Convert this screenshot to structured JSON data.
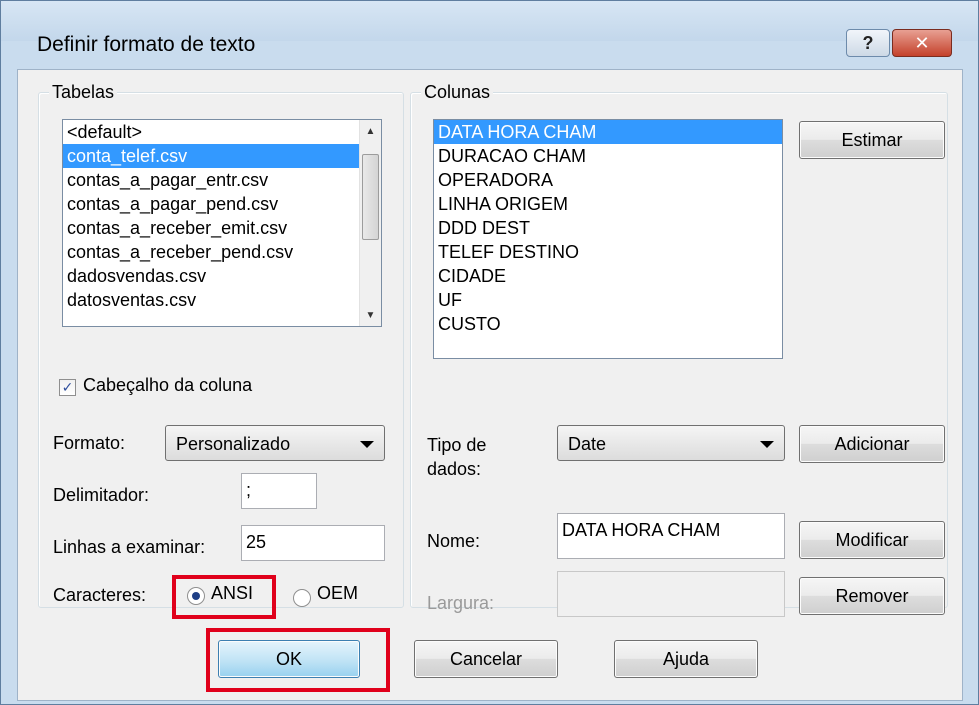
{
  "window": {
    "title": "Definir formato de texto",
    "help_glyph": "?",
    "close_glyph": "✕"
  },
  "tabelas": {
    "legend": "Tabelas",
    "items": [
      "<default>",
      "conta_telef.csv",
      "contas_a_pagar_entr.csv",
      "contas_a_pagar_pend.csv",
      "contas_a_receber_emit.csv",
      "contas_a_receber_pend.csv",
      "dadosvendas.csv",
      "datosventas.csv"
    ],
    "selected": "conta_telef.csv"
  },
  "colunas": {
    "legend": "Colunas",
    "items": [
      "DATA HORA CHAM",
      "DURACAO CHAM",
      "OPERADORA",
      "LINHA ORIGEM",
      "DDD DEST",
      "TELEF DESTINO",
      "CIDADE",
      "UF",
      "CUSTO"
    ],
    "selected": "DATA HORA CHAM",
    "estimar_label": "Estimar"
  },
  "left_form": {
    "header_check_label": "Cabeçalho da coluna",
    "header_checked": true,
    "formato_label": "Formato:",
    "formato_value": "Personalizado",
    "delimitador_label": "Delimitador:",
    "delimitador_value": ";",
    "linhas_label": "Linhas a examinar:",
    "linhas_value": "25",
    "caracteres_label": "Caracteres:",
    "ansi_label": "ANSI",
    "oem_label": "OEM",
    "caracteres_selected": "ANSI"
  },
  "right_form": {
    "tipo_label_line1": "Tipo de",
    "tipo_label_line2": "dados:",
    "tipo_value": "Date",
    "adicionar_label": "Adicionar",
    "nome_label": "Nome:",
    "nome_value": "DATA HORA CHAM",
    "modificar_label": "Modificar",
    "largura_label": "Largura:",
    "largura_value": "",
    "remover_label": "Remover"
  },
  "footer": {
    "ok_label": "OK",
    "cancelar_label": "Cancelar",
    "ajuda_label": "Ajuda"
  },
  "colors": {
    "selection": "#3399ff",
    "highlight_box": "#e0001b"
  }
}
